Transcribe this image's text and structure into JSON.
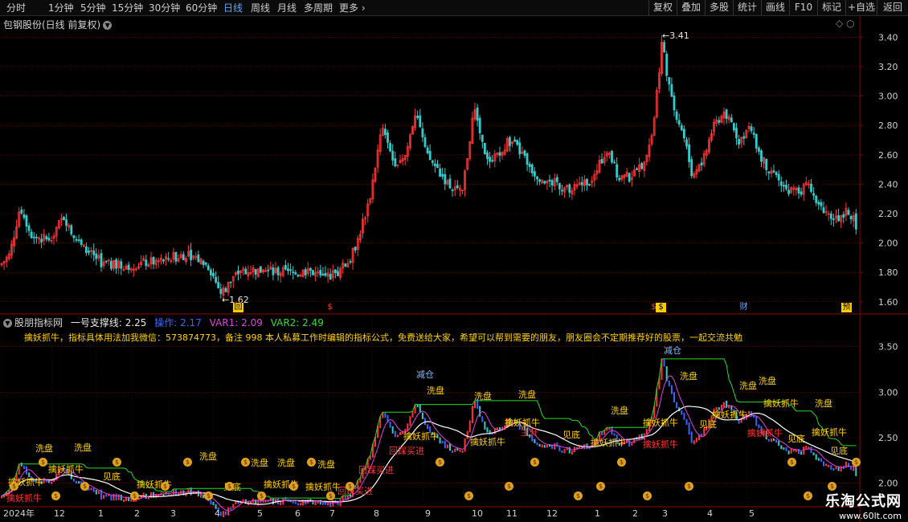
{
  "topbar": {
    "periods": [
      "分时",
      "1分钟",
      "5分钟",
      "15分钟",
      "30分钟",
      "60分钟",
      "日线",
      "周线",
      "月线",
      "多周期",
      "更多"
    ],
    "active": "日线",
    "right_buttons": [
      "复权",
      "叠加",
      "多股",
      "统计",
      "画线",
      "F10",
      "标记",
      "+自选",
      "返回"
    ]
  },
  "main": {
    "title": "包钢股份(日线 前复权)",
    "y_ticks": [
      "3.40",
      "3.20",
      "3.00",
      "2.80",
      "2.60",
      "2.40",
      "2.20",
      "2.00",
      "1.80",
      "1.60"
    ],
    "high_label": "3.41",
    "low_label": "1.62",
    "event_markers": [
      "回",
      "$",
      "$",
      "$",
      "财",
      "预"
    ]
  },
  "indicator": {
    "name": "股朋指标网",
    "lines": [
      {
        "label": "一号支撑线: 2.25",
        "color": "#e8e8e8"
      },
      {
        "label": "操作: 2.17",
        "color": "#3366ff"
      },
      {
        "label": "VAR1: 2.09",
        "color": "#e040e0"
      },
      {
        "label": "VAR2: 2.49",
        "color": "#33dd33"
      }
    ],
    "marquee": "擒妖抓牛，指标具体用法加我微信：573874773，备注 998 本人私募工作时编辑的指标公式，免费送给大家，希望可以帮到需要的朋友，朋友圈会不定期推荐好的股票，一起交流共勉",
    "y_ticks": [
      "3.50",
      "3.00",
      "2.50",
      "2.00"
    ],
    "signals": {
      "wash": "洗盘",
      "catch": "擒妖抓牛",
      "bottom": "见底",
      "reduce": "减仓",
      "pullback": "回踩买进",
      "rise": "主升"
    }
  },
  "x_axis": [
    "2024年",
    "12",
    "1",
    "2",
    "3",
    "4",
    "5",
    "6",
    "7",
    "8",
    "9",
    "10",
    "11",
    "12",
    "1",
    "2",
    "3",
    "4",
    "5"
  ],
  "watermark": {
    "name": "乐淘公式网",
    "url": "www.60lt.com"
  },
  "colors": {
    "up": "#ff3333",
    "down": "#33cccc",
    "grid": "#8b0000",
    "accent": "#5aa8ff",
    "signal": "#ffd200"
  }
}
